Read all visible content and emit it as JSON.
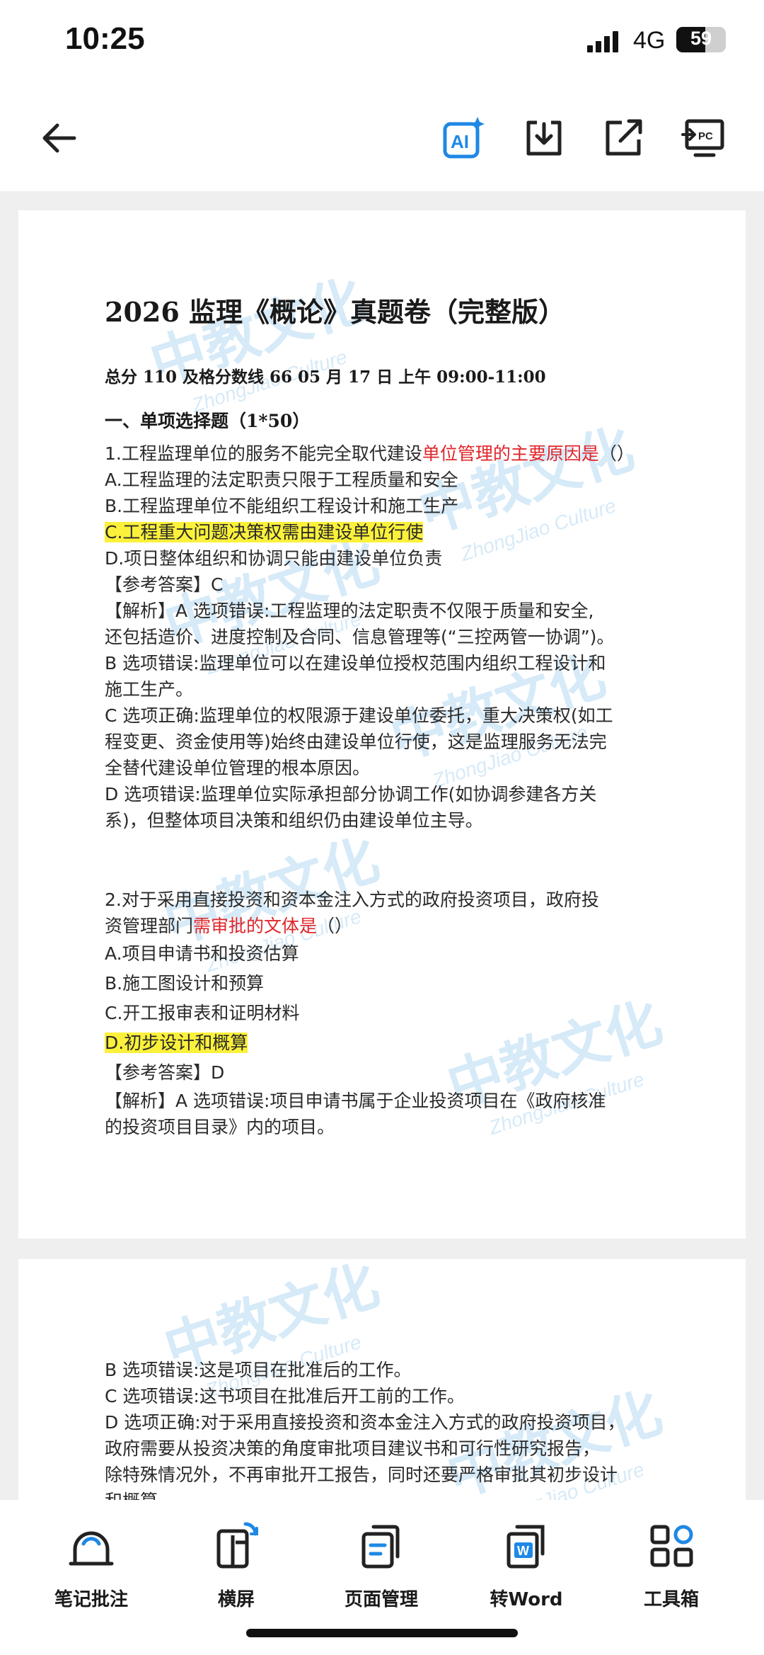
{
  "status": {
    "time": "10:25",
    "network": "4G",
    "battery": "59",
    "battery_level_percent": 59
  },
  "toolbar": {
    "icons": [
      "back-arrow-icon",
      "ai-icon",
      "download-icon",
      "share-icon",
      "pc-transfer-icon"
    ],
    "ai_icon_label": "AI",
    "pc_icon_label": "PC",
    "accent": "#1e88e5"
  },
  "document": {
    "title": "2026 监理《概论》真题卷（完整版）",
    "meta": "总分 110  及格分数线 66 05 月 17 日  上午 09:00-11:00",
    "section": "一、单项选择题（1*50）",
    "q1": {
      "stem_before": "1.工程监理单位的服务不能完全取代建设",
      "stem_red": "单位管理的主要原因是",
      "stem_after": "（）",
      "option_a": "A.工程监理的法定职责只限于工程质量和安全",
      "option_b": "B.工程监理单位不能组织工程设计和施工生产",
      "option_c": "C.工程重大问题决策权需由建设单位行使",
      "option_d": "D.项日整体组织和协调只能由建设单位负责",
      "answer": "【参考答案】C",
      "analysis": [
        "【解析】A 选项错误:工程监理的法定职责不仅限于质量和安全,",
        "还包括造价、进度控制及合同、信息管理等(“三控两管一协调”)。",
        "B 选项错误:监理单位可以在建设单位授权范围内组织工程设计和",
        "施工生产。",
        "C 选项正确:监理单位的权限源于建设单位委托，重大决策权(如工",
        "程变更、资金使用等)始终由建设单位行使，这是监理服务无法完",
        "全替代建设单位管理的根本原因。",
        "D  选项错误:监理单位实际承担部分协调工作(如协调参建各方关",
        "系)，但整体项目决策和组织仍由建设单位主导。"
      ]
    },
    "q2": {
      "stem_line1": "2.对于采用直接投资和资本金注入方式的政府投资项目，政府投",
      "stem_line2_before": "资管理部门",
      "stem_line2_red": "需审批的文体是",
      "stem_line2_after": "（）",
      "option_a": "A.项目申请书和投资估算",
      "option_b": "B.施工图设计和预算",
      "option_c": "C.开工报审表和证明材料",
      "option_d": "D.初步设计和概算",
      "answer": "【参考答案】D",
      "analysis": [
        "【解析】A 选项错误:项目申请书属于企业投资项目在《政府核准",
        "的投资项目目录》内的项目。"
      ]
    },
    "page2": [
      "B 选项错误:这是项目在批准后的工作。",
      "C 选项错误:这书项目在批准后开工前的工作。",
      "D  选项正确:对于采用直接投资和资本金注入方式的政府投资项目，",
      "政府需要从投资决策的角度审批项目建议书和可行性研究报告，",
      "除特殊情况外，不再审批开工报告，同时还要严格审批其初步设计",
      "和概算"
    ],
    "watermark": {
      "text": "中教文化",
      "sub": "ZhongJiao Culture"
    },
    "highlight_color": "#fbf13b",
    "emphasis_color": "#e0262a"
  },
  "bottom_nav": {
    "items": [
      {
        "label": "笔记批注",
        "icon": "annotate-icon"
      },
      {
        "label": "横屏",
        "icon": "rotate-icon"
      },
      {
        "label": "页面管理",
        "icon": "pages-icon"
      },
      {
        "label": "转Word",
        "icon": "word-icon"
      },
      {
        "label": "工具箱",
        "icon": "toolbox-icon"
      }
    ],
    "word_badge": "W"
  }
}
